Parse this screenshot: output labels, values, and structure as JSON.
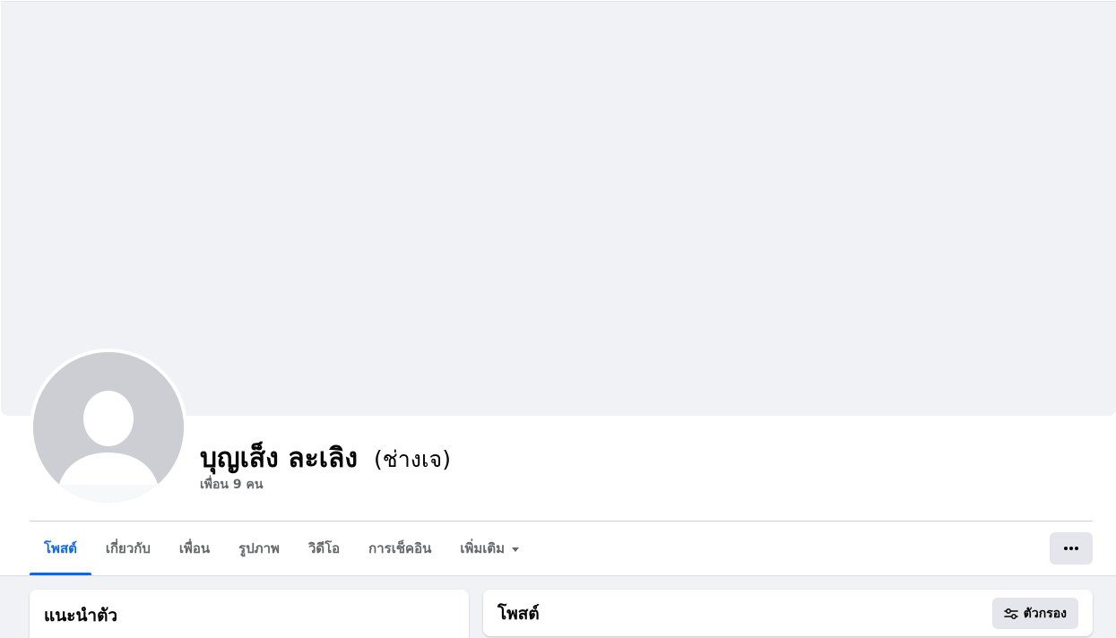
{
  "profile": {
    "name": "บุญเส็ง ละเลิง",
    "alternate_name": "(ช่างเจ)",
    "friends_count": "เพื่อน 9 คน"
  },
  "tabs": [
    {
      "label": "โพสต์",
      "active": true
    },
    {
      "label": "เกี่ยวกับ",
      "active": false
    },
    {
      "label": "เพื่อน",
      "active": false
    },
    {
      "label": "รูปภาพ",
      "active": false
    },
    {
      "label": "วิดีโอ",
      "active": false
    },
    {
      "label": "การเช็คอิน",
      "active": false
    },
    {
      "label": "เพิ่มเติม",
      "active": false
    }
  ],
  "intro": {
    "title": "แนะนำตัว"
  },
  "posts": {
    "title": "โพสต์",
    "filter_label": "ตัวกรอง"
  },
  "icons": {
    "more": "more-horizontal-icon",
    "filter": "sliders-icon",
    "dropdown": "caret-down-icon",
    "avatar": "default-avatar-icon"
  },
  "colors": {
    "accent": "#0866ff",
    "secondary_text": "#65676b",
    "background": "#f0f2f5",
    "button_gray": "#e4e6eb"
  }
}
